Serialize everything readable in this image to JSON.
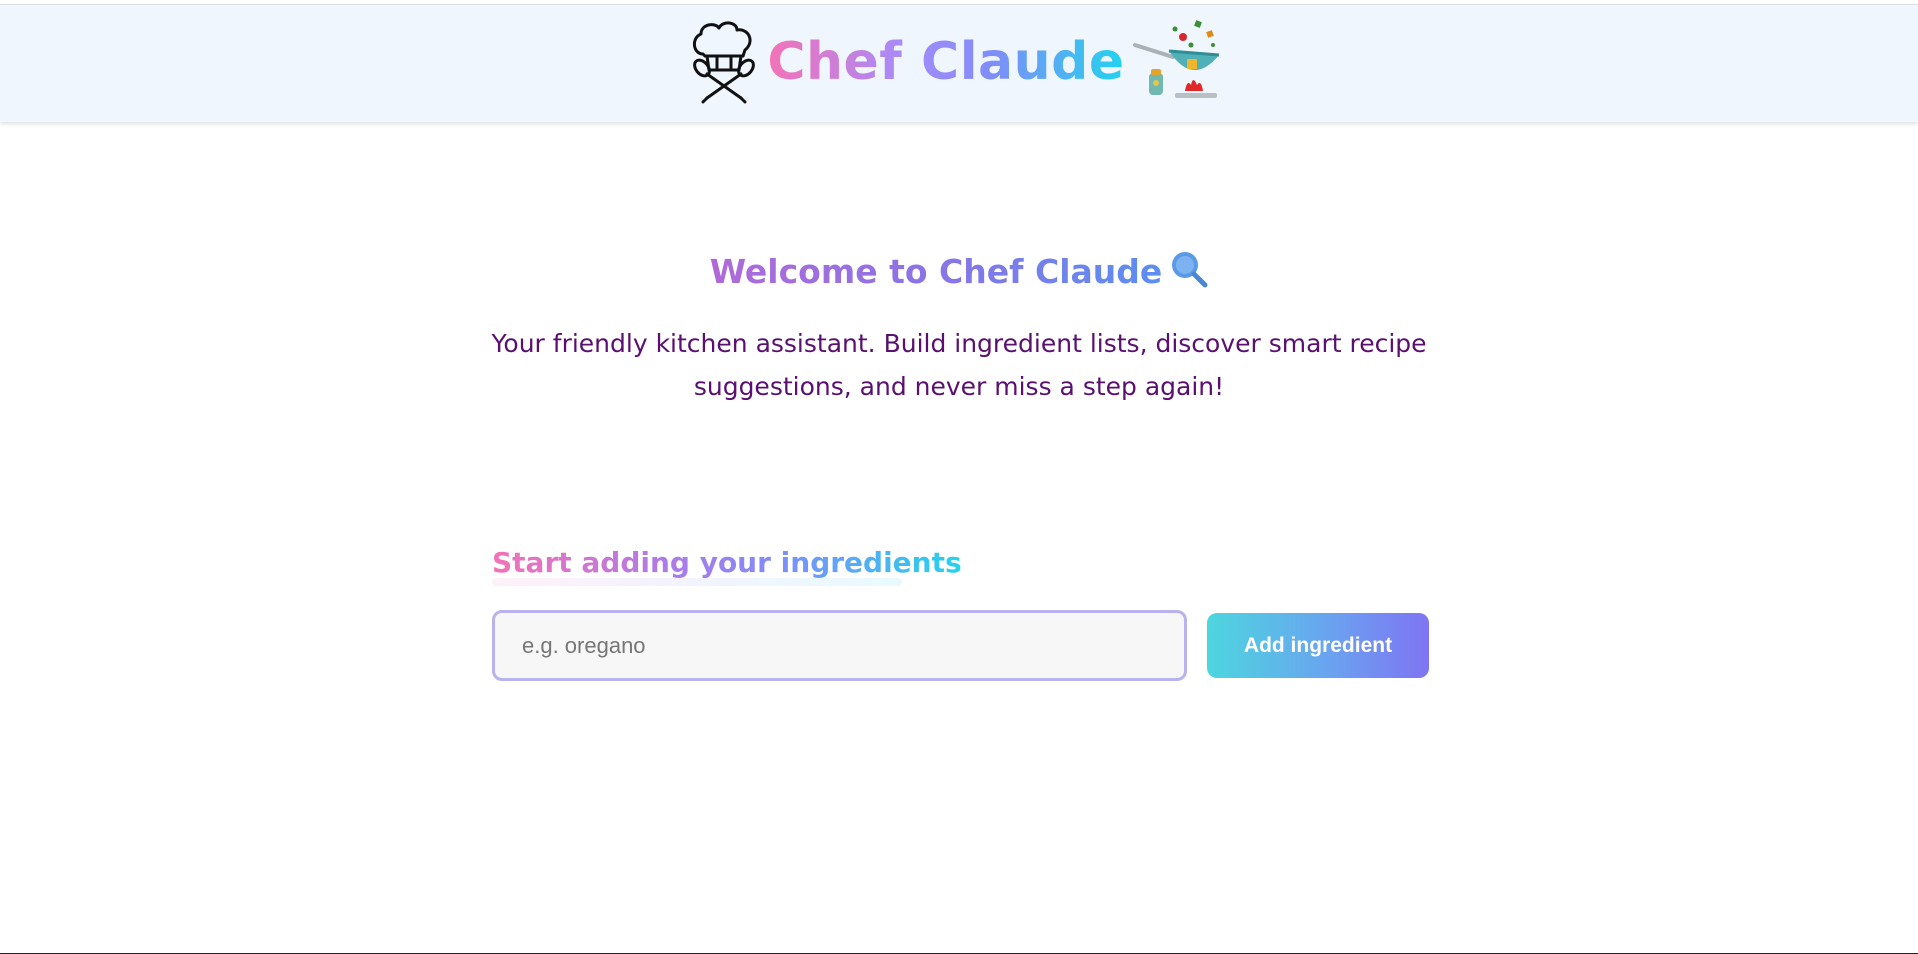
{
  "header": {
    "title": "Chef Claude",
    "logo_icon": "chef-hat-spoons-icon",
    "decor_icon": "wok-stove-icon"
  },
  "welcome": {
    "title": "Welcome to Chef Claude",
    "icon": "frying-pan-icon",
    "description": "Your friendly kitchen assistant. Build ingredient lists, discover smart recipe suggestions, and never miss a step again!"
  },
  "ingredients": {
    "heading": "Start adding your ingredients",
    "input_placeholder": "e.g. oregano",
    "input_value": "",
    "add_button_label": "Add ingredient"
  },
  "colors": {
    "header_bg": "#eff6fe",
    "description_text": "#5a1070",
    "gradient_pink": "#f472b6",
    "gradient_purple": "#818cf8",
    "gradient_cyan": "#22d3ee",
    "input_border": "#b8b2ee"
  }
}
